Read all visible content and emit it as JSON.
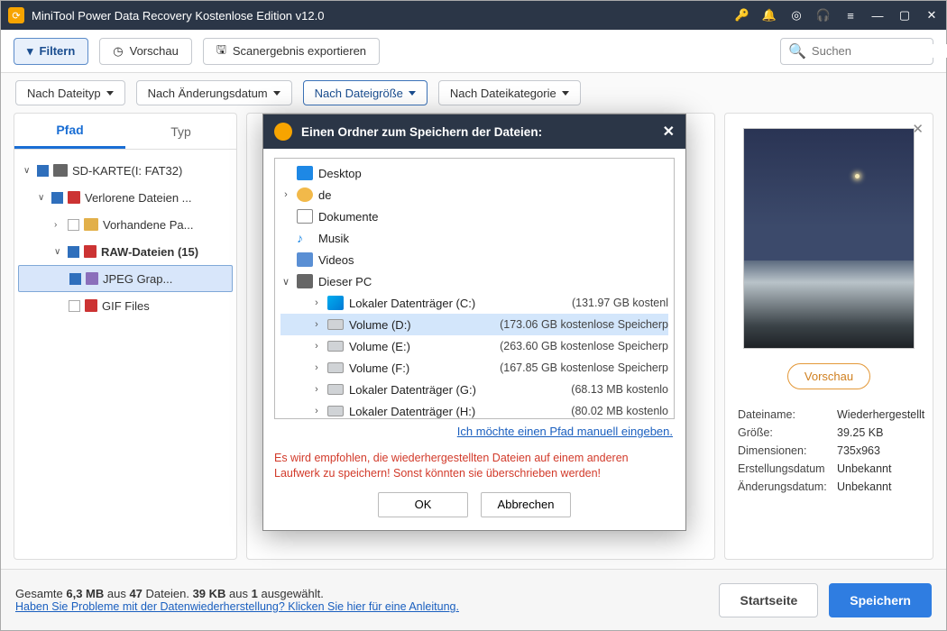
{
  "titlebar": {
    "title": "MiniTool Power Data Recovery Kostenlose Edition v12.0"
  },
  "toolbar": {
    "filter": "Filtern",
    "preview": "Vorschau",
    "export": "Scanergebnis exportieren",
    "search_placeholder": "Suchen"
  },
  "filters": {
    "byType": "Nach Dateityp",
    "byDate": "Nach Änderungsdatum",
    "bySize": "Nach Dateigröße",
    "byCategory": "Nach Dateikategorie"
  },
  "tabs": {
    "path": "Pfad",
    "type": "Typ"
  },
  "tree": {
    "root": "SD-KARTE(I: FAT32)",
    "lost": "Verlorene Dateien ...",
    "existing": "Vorhandene Pa...",
    "raw": "RAW-Dateien (15)",
    "jpeg": "JPEG Grap...",
    "gif": "GIF Files"
  },
  "previewPanel": {
    "button": "Vorschau",
    "rows": {
      "filename_k": "Dateiname:",
      "filename_v": "Wiederhergestellt",
      "size_k": "Größe:",
      "size_v": "39.25 KB",
      "dim_k": "Dimensionen:",
      "dim_v": "735x963",
      "created_k": "Erstellungsdatum",
      "created_v": "Unbekannt",
      "modified_k": "Änderungsdatum:",
      "modified_v": "Unbekannt"
    }
  },
  "footer": {
    "total_prefix": "Gesamte ",
    "total_size": "6,3 MB",
    "total_mid": " aus ",
    "total_files": "47",
    "total_suffix": " Dateien.  ",
    "sel_size": "39 KB",
    "sel_mid": " aus ",
    "sel_count": "1",
    "sel_suffix": " ausgewählt.",
    "help_link": "Haben Sie Probleme mit der Datenwiederherstellung? Klicken Sie hier für eine Anleitung.",
    "home": "Startseite",
    "save": "Speichern"
  },
  "modal": {
    "title": "Einen Ordner zum Speichern der Dateien:",
    "items": {
      "desktop": "Desktop",
      "user": "de",
      "documents": "Dokumente",
      "music": "Musik",
      "videos": "Videos",
      "thispc": "Dieser PC"
    },
    "drives": [
      {
        "label": "Lokaler Datenträger (C:)",
        "info": "(131.97 GB kostenl"
      },
      {
        "label": "Volume (D:)",
        "info": "(173.06 GB kostenlose Speicherp",
        "selected": true
      },
      {
        "label": "Volume (E:)",
        "info": "(263.60 GB kostenlose Speicherp"
      },
      {
        "label": "Volume (F:)",
        "info": "(167.85 GB kostenlose Speicherp"
      },
      {
        "label": "Lokaler Datenträger (G:)",
        "info": "(68.13 MB kostenlo"
      },
      {
        "label": "Lokaler Datenträger (H:)",
        "info": "(80.02 MB kostenlo"
      }
    ],
    "manual_link": "Ich möchte einen Pfad manuell eingeben.",
    "warning": "Es wird empfohlen, die wiederhergestellten Dateien auf einem anderen Laufwerk zu speichern! Sonst könnten sie überschrieben werden!",
    "ok": "OK",
    "cancel": "Abbrechen"
  }
}
